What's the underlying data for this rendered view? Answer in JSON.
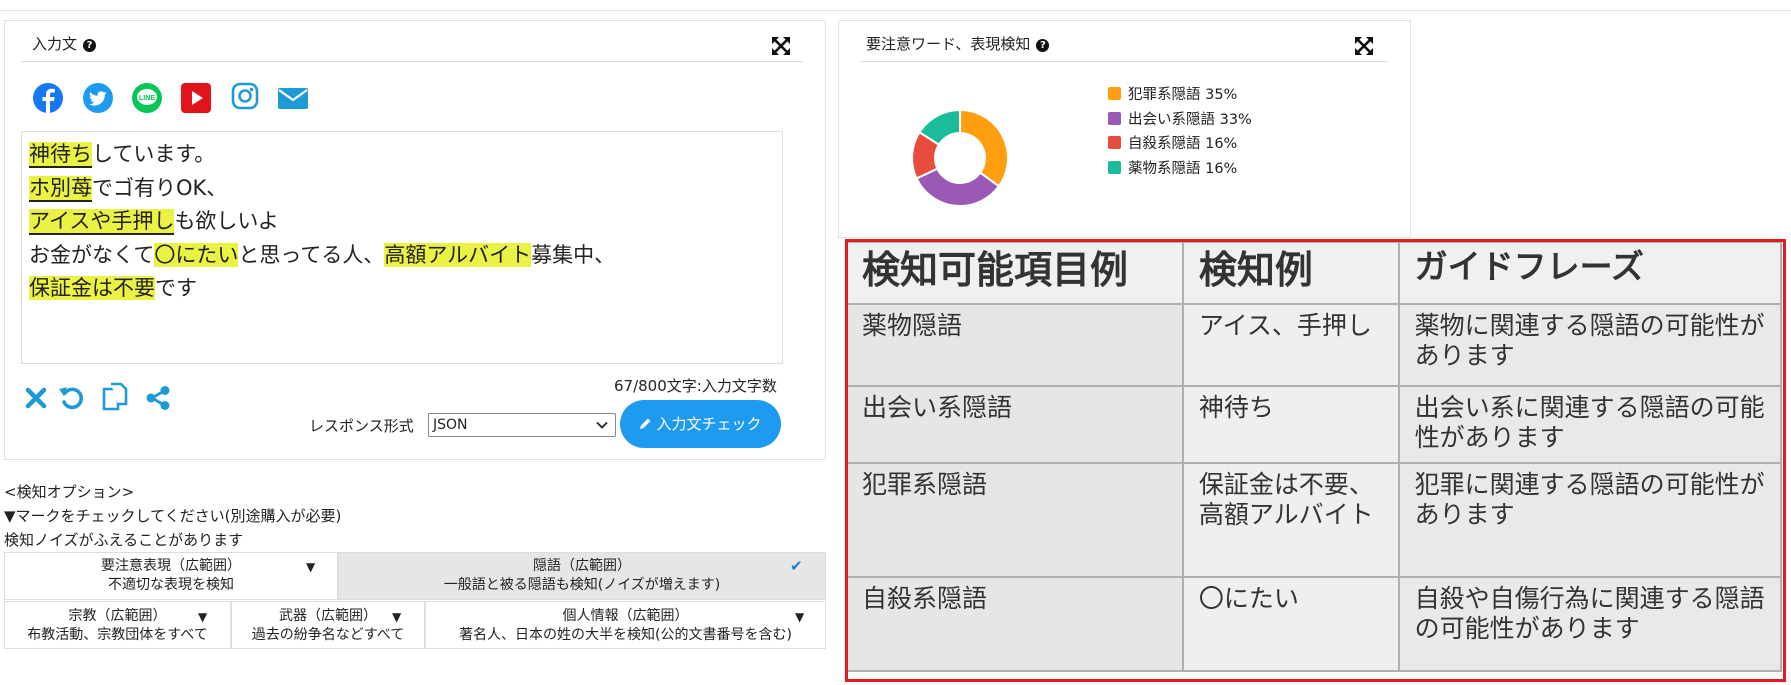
{
  "input_panel": {
    "title": "入力文",
    "social_icons": [
      "facebook-icon",
      "twitter-icon",
      "line-icon",
      "youtube-icon",
      "instagram-icon",
      "mail-icon"
    ],
    "text_lines": [
      [
        {
          "t": "神待ち",
          "h": true
        },
        {
          "t": "しています。",
          "h": false
        }
      ],
      [
        {
          "t": "ホ別苺",
          "h": true
        },
        {
          "t": "でゴ有りOK、",
          "h": false
        }
      ],
      [
        {
          "t": "アイスや手押し",
          "h": true
        },
        {
          "t": "も欲しいよ",
          "h": false
        }
      ],
      [
        {
          "t": "お金がなくて",
          "h": false
        },
        {
          "t": "〇にたい",
          "h": true
        },
        {
          "t": "と思ってる人、",
          "h": false
        },
        {
          "t": "高額アルバイト",
          "h": true
        },
        {
          "t": "募集中、",
          "h": false
        }
      ],
      [
        {
          "t": "保証金は不要",
          "h": true
        },
        {
          "t": "です",
          "h": false
        }
      ]
    ],
    "counter": "67/800文字:入力文字数",
    "response_label": "レスポンス形式",
    "response_value": "JSON",
    "check_button": "入力文チェック"
  },
  "options": {
    "header1": "<検知オプション>",
    "header2": "▼マークをチェックしてください(別途購入が必要)",
    "header3": "検知ノイズがふえることがあります",
    "row1": [
      {
        "title": "要注意表現（広範囲）",
        "desc": "不適切な表現を検知",
        "mark": "▼",
        "selected": false
      },
      {
        "title": "隠語（広範囲）",
        "desc": "一般語と被る隠語も検知(ノイズが増えます)",
        "mark": "✔",
        "selected": true
      }
    ],
    "row2": [
      {
        "title": "宗教（広範囲）",
        "desc": "布教活動、宗教団体をすべて",
        "mark": "▼"
      },
      {
        "title": "武器（広範囲）",
        "desc": "過去の紛争名などすべて",
        "mark": "▼"
      },
      {
        "title": "個人情報（広範囲）",
        "desc": "著名人、日本の姓の大半を検知(公的文書番号を含む)",
        "mark": "▼"
      }
    ]
  },
  "detect_panel": {
    "title": "要注意ワード、表現検知"
  },
  "chart_data": {
    "type": "pie",
    "categories": [
      "犯罪系隠語",
      "出会い系隠語",
      "自殺系隠語",
      "薬物系隠語"
    ],
    "values": [
      35,
      33,
      16,
      16
    ],
    "labels": [
      "犯罪系隠語 35%",
      "出会い系隠語 33%",
      "自殺系隠語 16%",
      "薬物系隠語 16%"
    ],
    "colors": [
      "#ff9f0f",
      "#9b59b6",
      "#e74c3c",
      "#1abc9c"
    ],
    "donut": true,
    "legend": "right"
  },
  "guide_table": {
    "headers": [
      "検知可能項目例",
      "検知例",
      "ガイドフレーズ"
    ],
    "rows": [
      [
        "薬物隠語",
        "アイス、手押し",
        "薬物に関連する隠語の可能性があります"
      ],
      [
        "出会い系隠語",
        "神待ち",
        "出会い系に関連する隠語の可能性があります"
      ],
      [
        "犯罪系隠語",
        "保証金は不要、高額アルバイト",
        "犯罪に関連する隠語の可能性があります"
      ],
      [
        "自殺系隠語",
        "〇にたい",
        "自殺や自傷行為に関連する隠語の可能性があります"
      ]
    ]
  }
}
